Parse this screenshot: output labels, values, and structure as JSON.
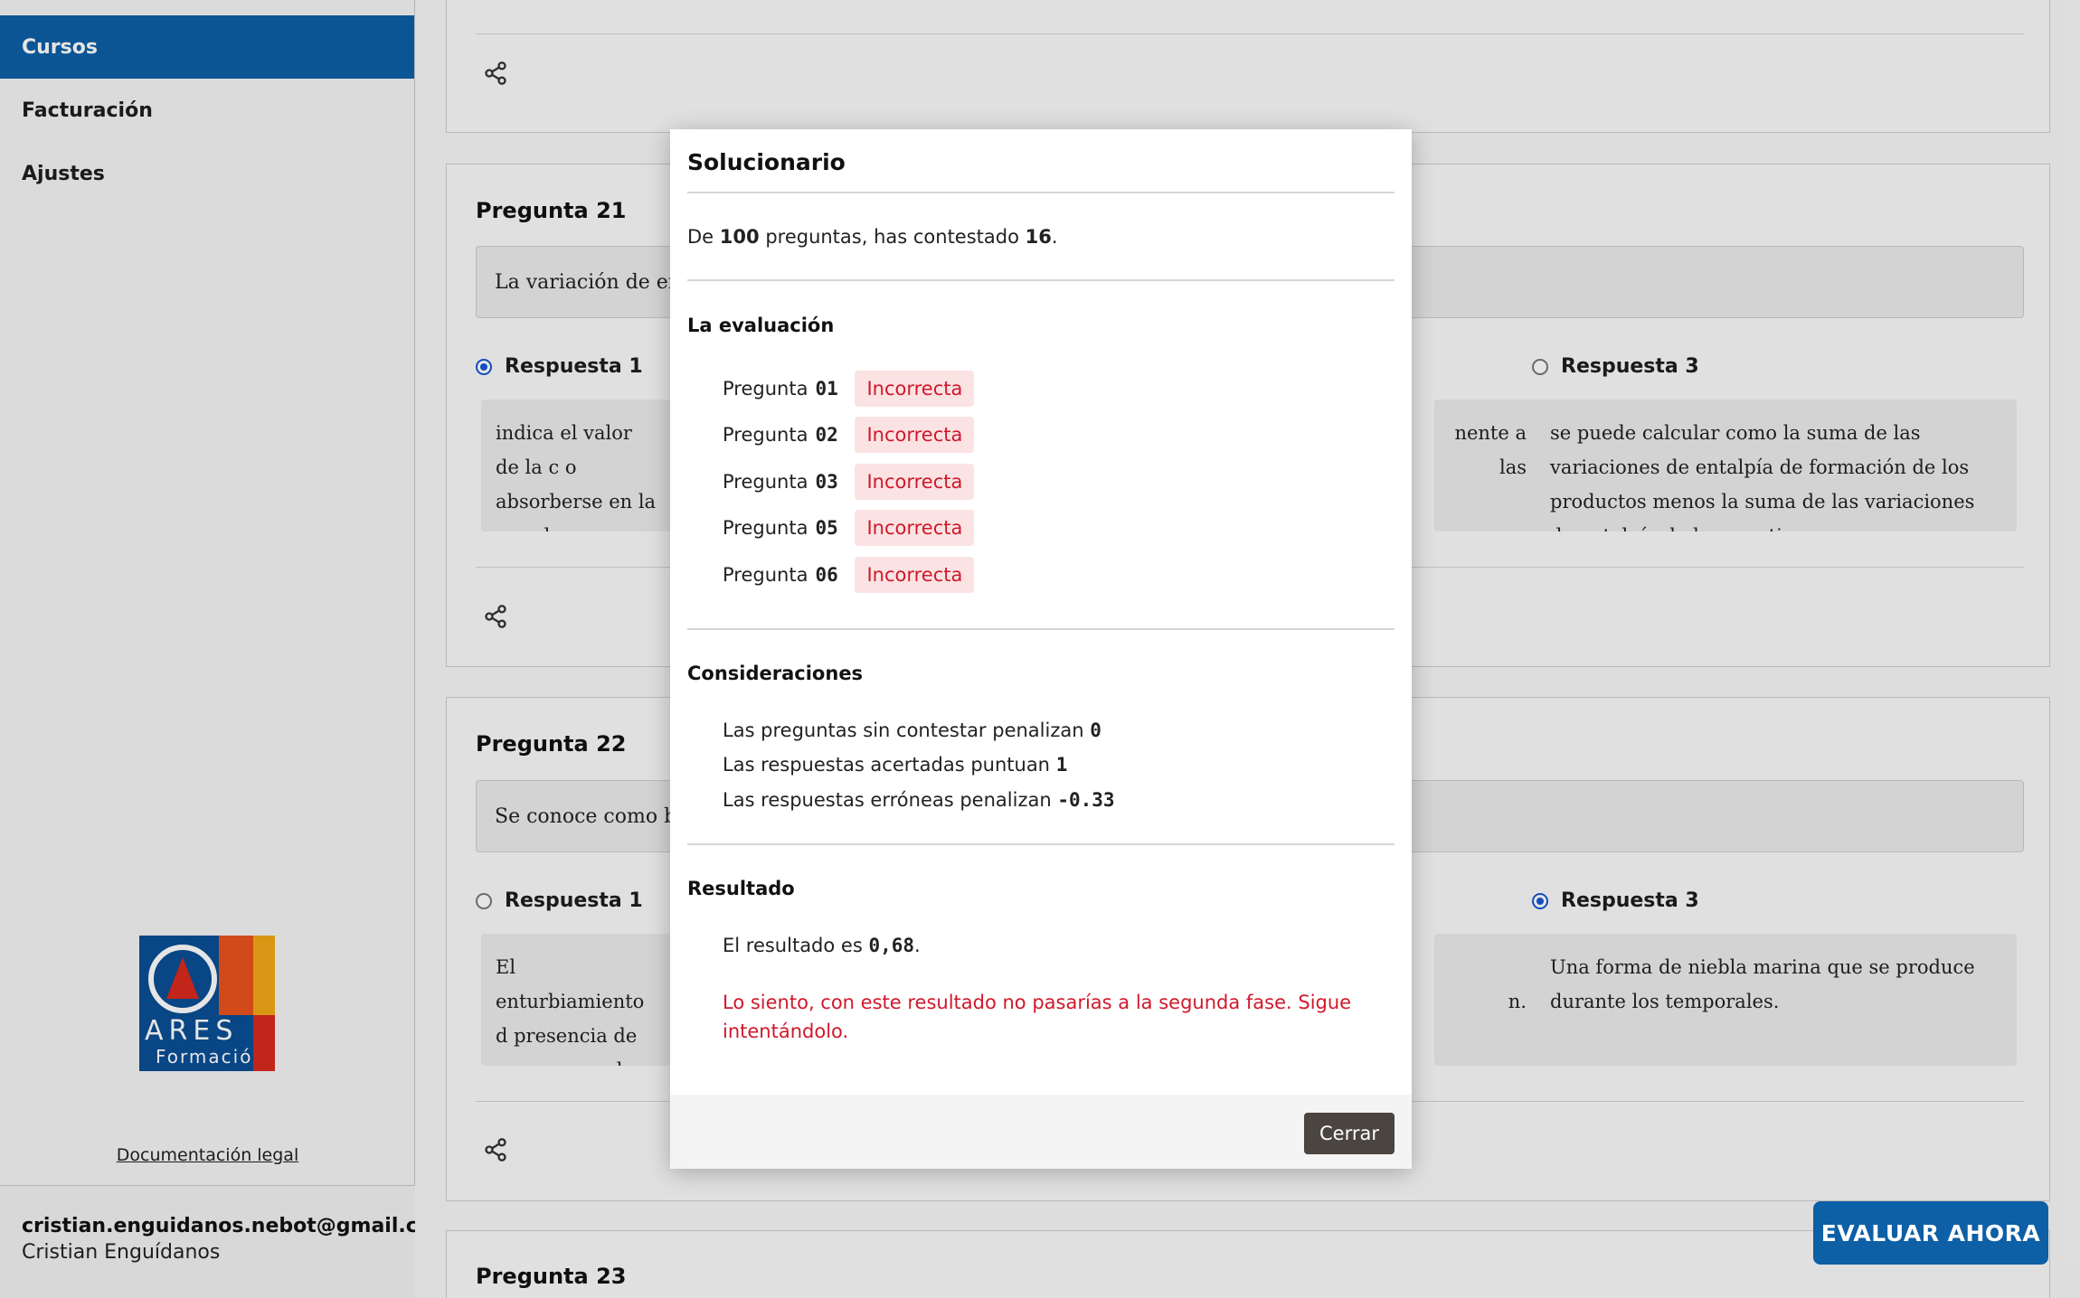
{
  "sidebar": {
    "items": [
      {
        "label": "Cursos"
      },
      {
        "label": "Facturación"
      },
      {
        "label": "Ajustes"
      }
    ],
    "logo": {
      "text_top": "ARES",
      "text_bottom": "Formació"
    },
    "legal": "Documentación legal",
    "user": {
      "email": "cristian.enguidanos.nebot@gmail.com",
      "name": "Cristian Enguídanos"
    }
  },
  "questions": [
    {
      "title": "Pregunta 21",
      "text": "La variación de enta",
      "options": [
        {
          "label": "Respuesta 1",
          "checked": true,
          "text": "indica el valor de la c o absorberse en la re volumen constante."
        },
        {
          "label": "Respuesta 3",
          "checked": false,
          "text": "se puede calcular como la suma de las variaciones de entalpía de formación de los productos menos la suma de las variaciones de entalpía de los reactivos."
        }
      ],
      "partial_text": "nente a las"
    },
    {
      "title": "Pregunta 22",
      "text": "Se conoce como bru",
      "options": [
        {
          "label": "Respuesta 1",
          "checked": false,
          "text": "El enturbiamiento d presencia de numero en el aire en zona de"
        },
        {
          "label": "Respuesta 3",
          "checked": true,
          "text": "Una forma de niebla marina que se produce durante los temporales."
        }
      ],
      "partial_text": "n."
    },
    {
      "title": "Pregunta 23"
    }
  ],
  "modal": {
    "title": "Solucionario",
    "summary": {
      "prefix": "De",
      "total": "100",
      "middle": "preguntas, has contestado",
      "answered": "16",
      "suffix": "."
    },
    "evaluation_heading": "La evaluación",
    "evaluation": [
      {
        "label": "Pregunta",
        "num": "01",
        "status": "Incorrecta"
      },
      {
        "label": "Pregunta",
        "num": "02",
        "status": "Incorrecta"
      },
      {
        "label": "Pregunta",
        "num": "03",
        "status": "Incorrecta"
      },
      {
        "label": "Pregunta",
        "num": "05",
        "status": "Incorrecta"
      },
      {
        "label": "Pregunta",
        "num": "06",
        "status": "Incorrecta"
      }
    ],
    "considerations_heading": "Consideraciones",
    "considerations": [
      {
        "text": "Las preguntas sin contestar penalizan",
        "value": "0"
      },
      {
        "text": "Las respuestas acertadas puntuan",
        "value": "1"
      },
      {
        "text": "Las respuestas erróneas penalizan",
        "value": "-0.33"
      }
    ],
    "result_heading": "Resultado",
    "result": {
      "prefix": "El resultado es",
      "value": "0,68",
      "suffix": "."
    },
    "warning": "Lo siento, con este resultado no pasarías a la segunda fase. Sigue intentándolo.",
    "close_label": "Cerrar"
  },
  "evaluate_button": "EVALUAR AHORA",
  "colors": {
    "primary": "#0d5fa6",
    "error": "#d0182b",
    "error_bg": "#fbe3e3"
  }
}
